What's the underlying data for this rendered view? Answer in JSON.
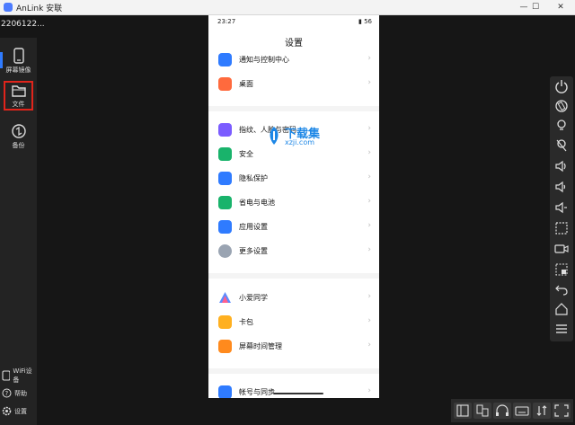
{
  "window": {
    "title": "AnLink 安联",
    "minimize": "—",
    "maximize": "☐",
    "close": "✕"
  },
  "device": {
    "name": "2206122..."
  },
  "sidebar": {
    "items": [
      {
        "label": "屏幕镜像",
        "icon": "phone-icon"
      },
      {
        "label": "文件",
        "icon": "folder-icon"
      },
      {
        "label": "备份",
        "icon": "sync-icon"
      }
    ],
    "bottom": [
      {
        "label": "WiFi设备",
        "icon": "wifi-device-icon"
      },
      {
        "label": "帮助",
        "icon": "help-icon"
      },
      {
        "label": "设置",
        "icon": "gear-icon"
      }
    ]
  },
  "phone": {
    "status_time": "23:27",
    "status_right": "▮ 56",
    "heading": "设置",
    "groups": [
      [
        {
          "label": "通知与控制中心",
          "color": "#2f7bff"
        },
        {
          "label": "桌面",
          "color": "#ff6a3d"
        }
      ],
      [
        {
          "label": "指纹、人脸与密码",
          "color": "#7b5cff"
        },
        {
          "label": "安全",
          "color": "#19b36b"
        },
        {
          "label": "隐私保护",
          "color": "#2f7bff"
        },
        {
          "label": "省电与电池",
          "color": "#19b36b"
        },
        {
          "label": "应用设置",
          "color": "#2f7bff"
        },
        {
          "label": "更多设置",
          "color": "#9aa4b2"
        }
      ],
      [
        {
          "label": "小爱同学",
          "color": "#ffffff"
        },
        {
          "label": "卡包",
          "color": "#ffb020"
        },
        {
          "label": "屏幕时间管理",
          "color": "#ff8a1d"
        }
      ],
      [
        {
          "label": "帐号与同步",
          "color": "#2f7bff"
        }
      ]
    ],
    "chevron": "›"
  },
  "watermark": {
    "big": "下载集",
    "small": "xzji.com"
  },
  "rightbar": {
    "buttons": [
      "power-icon",
      "rotate-icon",
      "bulb-icon",
      "bulb-off-icon",
      "volume-up-icon",
      "volume-down-icon",
      "mute-icon",
      "screenshot-icon",
      "record-icon",
      "crop-icon",
      "back-icon",
      "home-icon",
      "menu-icon"
    ]
  },
  "bottombar": {
    "buttons": [
      "window-icon",
      "transfer-icon",
      "headset-icon",
      "keyboard-icon",
      "swap-icon",
      "fullscreen-icon"
    ]
  }
}
